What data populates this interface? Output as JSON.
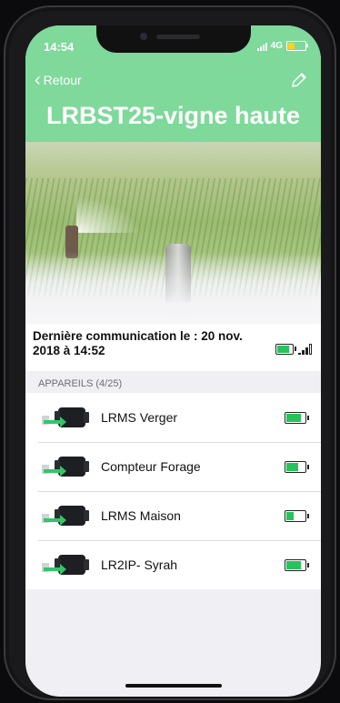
{
  "status_bar": {
    "time": "14:54",
    "network": "4G",
    "battery_color": "#ffd21a"
  },
  "nav": {
    "back_label": "Retour",
    "edit_icon": "pencil-icon"
  },
  "header": {
    "title": "LRBST25-vigne haute",
    "color": "#7ed99a"
  },
  "communication": {
    "text": "Dernière communication le : 20 nov. 2018 à 14:52",
    "battery_level": 0.85,
    "signal_bars": 3
  },
  "devices_section": {
    "label": "APPAREILS (4/25)"
  },
  "devices": [
    {
      "name": "LRMS Verger",
      "battery_level": 0.9
    },
    {
      "name": "Compteur Forage",
      "battery_level": 0.7
    },
    {
      "name": "LRMS Maison",
      "battery_level": 0.45
    },
    {
      "name": "LR2IP- Syrah",
      "battery_level": 0.9
    }
  ],
  "accent_green": "#27c35a",
  "arrow_green": "#35c46a"
}
